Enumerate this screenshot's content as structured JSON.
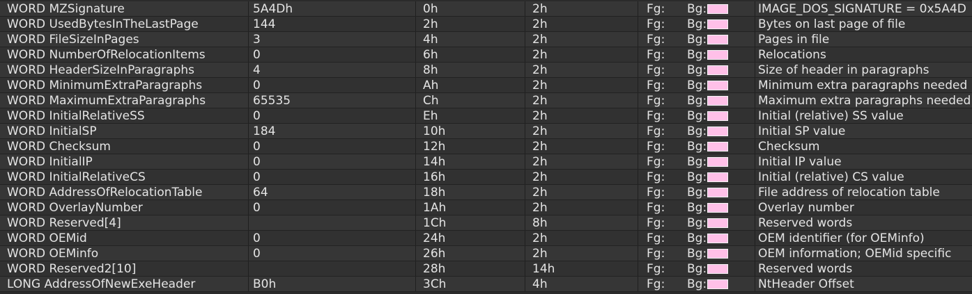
{
  "bg_swatch_color": "#ffc0e8",
  "rows": [
    {
      "name": "WORD MZSignature",
      "value": "5A4Dh",
      "start": "0h",
      "size": "2h",
      "fg": "Fg:",
      "bg": "Bg:",
      "comment": "IMAGE_DOS_SIGNATURE = 0x5A4D"
    },
    {
      "name": "WORD UsedBytesInTheLastPage",
      "value": "144",
      "start": "2h",
      "size": "2h",
      "fg": "Fg:",
      "bg": "Bg:",
      "comment": "Bytes on last page of file"
    },
    {
      "name": "WORD FileSizeInPages",
      "value": "3",
      "start": "4h",
      "size": "2h",
      "fg": "Fg:",
      "bg": "Bg:",
      "comment": "Pages in file"
    },
    {
      "name": "WORD NumberOfRelocationItems",
      "value": "0",
      "start": "6h",
      "size": "2h",
      "fg": "Fg:",
      "bg": "Bg:",
      "comment": "Relocations"
    },
    {
      "name": "WORD HeaderSizeInParagraphs",
      "value": "4",
      "start": "8h",
      "size": "2h",
      "fg": "Fg:",
      "bg": "Bg:",
      "comment": "Size of header in paragraphs"
    },
    {
      "name": "WORD MinimumExtraParagraphs",
      "value": "0",
      "start": "Ah",
      "size": "2h",
      "fg": "Fg:",
      "bg": "Bg:",
      "comment": "Minimum extra paragraphs needed"
    },
    {
      "name": "WORD MaximumExtraParagraphs",
      "value": "65535",
      "start": "Ch",
      "size": "2h",
      "fg": "Fg:",
      "bg": "Bg:",
      "comment": "Maximum extra paragraphs needed"
    },
    {
      "name": "WORD InitialRelativeSS",
      "value": "0",
      "start": "Eh",
      "size": "2h",
      "fg": "Fg:",
      "bg": "Bg:",
      "comment": "Initial (relative) SS value"
    },
    {
      "name": "WORD InitialSP",
      "value": "184",
      "start": "10h",
      "size": "2h",
      "fg": "Fg:",
      "bg": "Bg:",
      "comment": "Initial SP value"
    },
    {
      "name": "WORD Checksum",
      "value": "0",
      "start": "12h",
      "size": "2h",
      "fg": "Fg:",
      "bg": "Bg:",
      "comment": "Checksum"
    },
    {
      "name": "WORD InitialIP",
      "value": "0",
      "start": "14h",
      "size": "2h",
      "fg": "Fg:",
      "bg": "Bg:",
      "comment": "Initial IP value"
    },
    {
      "name": "WORD InitialRelativeCS",
      "value": "0",
      "start": "16h",
      "size": "2h",
      "fg": "Fg:",
      "bg": "Bg:",
      "comment": "Initial (relative) CS value"
    },
    {
      "name": "WORD AddressOfRelocationTable",
      "value": "64",
      "start": "18h",
      "size": "2h",
      "fg": "Fg:",
      "bg": "Bg:",
      "comment": "File address of relocation table"
    },
    {
      "name": "WORD OverlayNumber",
      "value": "0",
      "start": "1Ah",
      "size": "2h",
      "fg": "Fg:",
      "bg": "Bg:",
      "comment": "Overlay number"
    },
    {
      "name": "WORD Reserved[4]",
      "value": "",
      "start": "1Ch",
      "size": "8h",
      "fg": "Fg:",
      "bg": "Bg:",
      "comment": "Reserved words"
    },
    {
      "name": "WORD OEMid",
      "value": "0",
      "start": "24h",
      "size": "2h",
      "fg": "Fg:",
      "bg": "Bg:",
      "comment": "OEM identifier (for OEMinfo)"
    },
    {
      "name": "WORD OEMinfo",
      "value": "0",
      "start": "26h",
      "size": "2h",
      "fg": "Fg:",
      "bg": "Bg:",
      "comment": "OEM information; OEMid specific"
    },
    {
      "name": "WORD Reserved2[10]",
      "value": "",
      "start": "28h",
      "size": "14h",
      "fg": "Fg:",
      "bg": "Bg:",
      "comment": "Reserved words"
    },
    {
      "name": "LONG AddressOfNewExeHeader",
      "value": "B0h",
      "start": "3Ch",
      "size": "4h",
      "fg": "Fg:",
      "bg": "Bg:",
      "comment": "NtHeader Offset"
    }
  ]
}
